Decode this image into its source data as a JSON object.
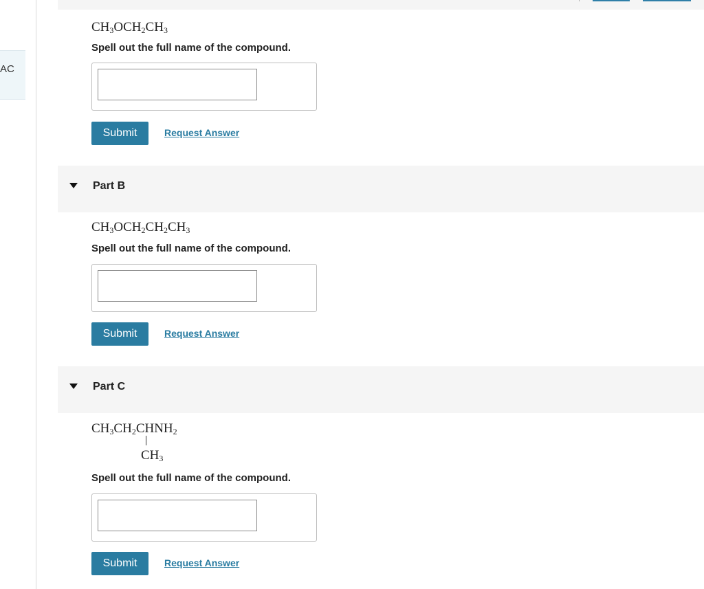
{
  "sidebar": {
    "tab_label": "AC"
  },
  "part_a": {
    "formula": [
      {
        "t": "CH"
      },
      {
        "s": "3"
      },
      {
        "t": "OCH"
      },
      {
        "s": "2"
      },
      {
        "t": "CH"
      },
      {
        "s": "3"
      }
    ],
    "prompt": "Spell out the full name of the compound.",
    "input_value": "",
    "submit_label": "Submit",
    "request_label": "Request Answer"
  },
  "part_b": {
    "title": "Part B",
    "formula": [
      {
        "t": "CH"
      },
      {
        "s": "3"
      },
      {
        "t": "OCH"
      },
      {
        "s": "2"
      },
      {
        "t": "CH"
      },
      {
        "s": "2"
      },
      {
        "t": "CH"
      },
      {
        "s": "3"
      }
    ],
    "prompt": "Spell out the full name of the compound.",
    "input_value": "",
    "submit_label": "Submit",
    "request_label": "Request Answer"
  },
  "part_c": {
    "title": "Part C",
    "formula": [
      {
        "t": "CH"
      },
      {
        "s": "3"
      },
      {
        "t": "CH"
      },
      {
        "s": "2"
      },
      {
        "t": "CHNH"
      },
      {
        "s": "2"
      }
    ],
    "branch": [
      {
        "t": "CH"
      },
      {
        "s": "3"
      }
    ],
    "prompt": "Spell out the full name of the compound.",
    "input_value": "",
    "submit_label": "Submit",
    "request_label": "Request Answer"
  }
}
